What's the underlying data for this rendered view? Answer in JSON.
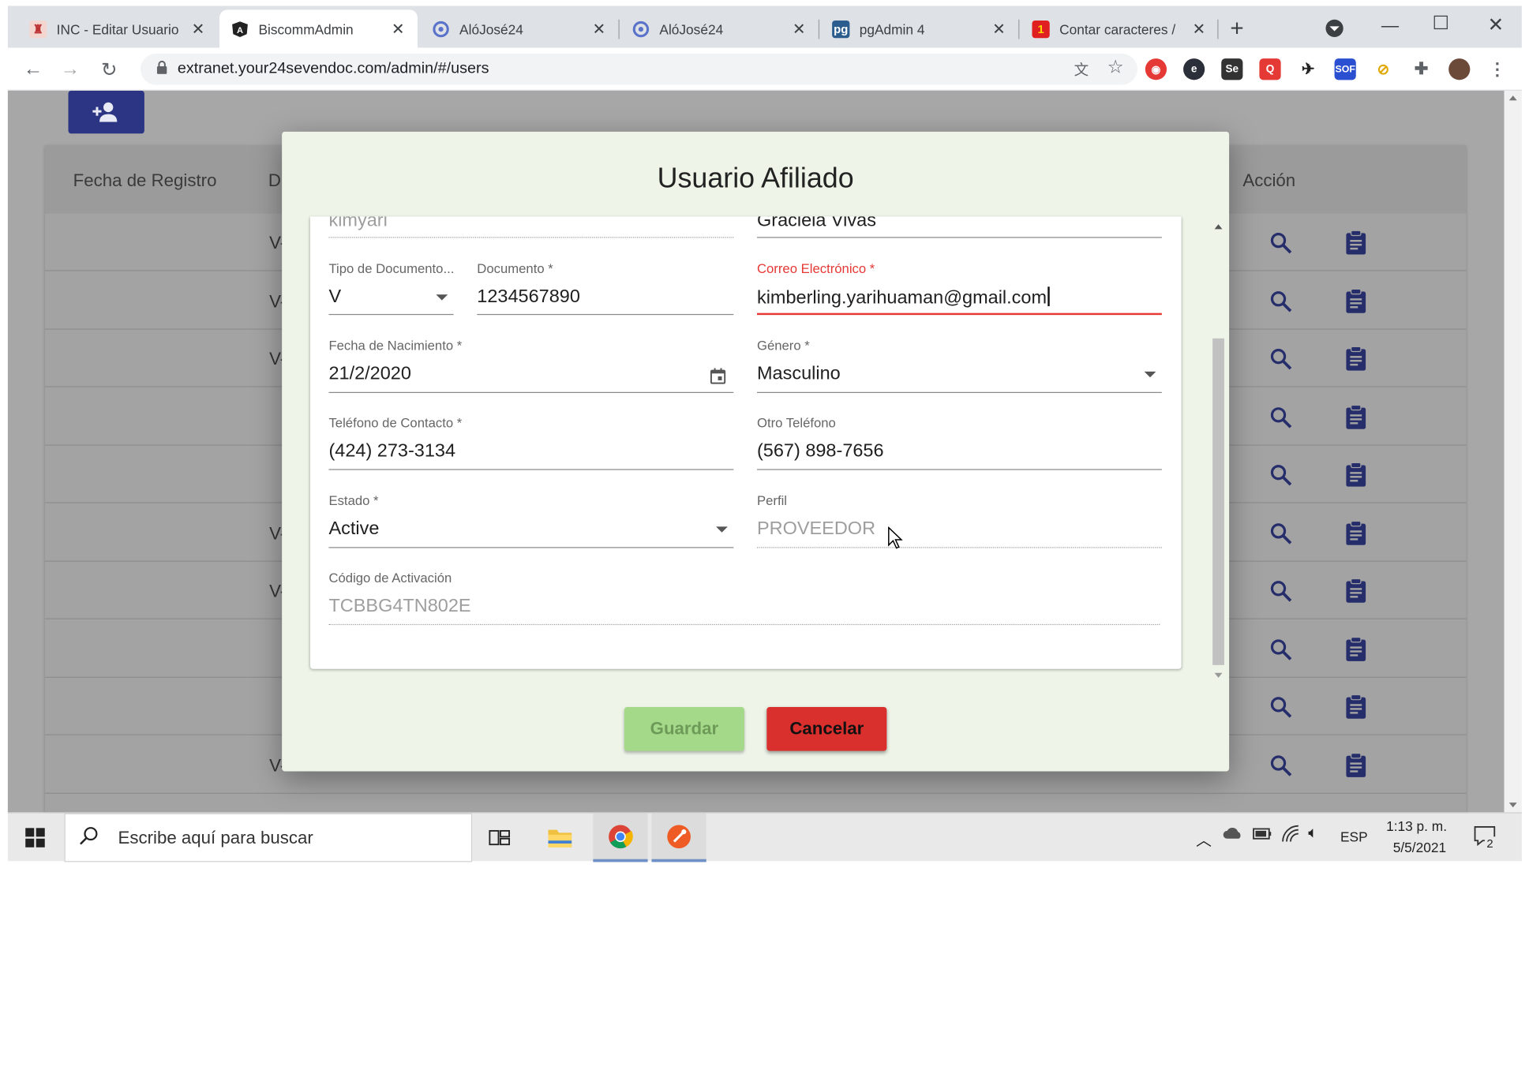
{
  "browser": {
    "tabs": [
      {
        "title": "INC - Editar Usuario",
        "icon": "inc-favicon",
        "active": false
      },
      {
        "title": "BiscommAdmin",
        "icon": "angular-favicon",
        "active": true
      },
      {
        "title": "AlóJosé24",
        "icon": "alojose-favicon",
        "active": false
      },
      {
        "title": "AlóJosé24",
        "icon": "alojose-favicon",
        "active": false
      },
      {
        "title": "pgAdmin 4",
        "icon": "pgadmin-favicon",
        "active": false
      },
      {
        "title": "Contar caracteres /",
        "icon": "counter-favicon",
        "active": false
      }
    ],
    "url": "extranet.your24sevendoc.com/admin/#/users"
  },
  "table": {
    "headers": {
      "fecha": "Fecha de Registro",
      "doc": "D",
      "accion": "Acción"
    },
    "rows": [
      {
        "doc": "V-"
      },
      {
        "doc": "V-"
      },
      {
        "doc": "V-"
      },
      {
        "doc": ""
      },
      {
        "doc": ""
      },
      {
        "doc": "V-"
      },
      {
        "doc": "V-"
      },
      {
        "doc": ""
      },
      {
        "doc": ""
      },
      {
        "doc": "V-"
      }
    ]
  },
  "modal": {
    "title": "Usuario Afiliado",
    "fields": {
      "top_left_value": "kimyari",
      "top_right_value": "Graciela Vivas",
      "tipo_documento": {
        "label": "Tipo de Documento...",
        "value": "V"
      },
      "documento": {
        "label": "Documento *",
        "value": "1234567890"
      },
      "correo": {
        "label": "Correo Electrónico *",
        "value": "kimberling.yarihuaman@gmail.com"
      },
      "fecha_nacimiento": {
        "label": "Fecha de Nacimiento *",
        "value": "21/2/2020"
      },
      "genero": {
        "label": "Género *",
        "value": "Masculino"
      },
      "telefono": {
        "label": "Teléfono de Contacto *",
        "value": "(424) 273-3134"
      },
      "otro_telefono": {
        "label": "Otro Teléfono",
        "value": "(567) 898-7656"
      },
      "estado": {
        "label": "Estado *",
        "value": "Active"
      },
      "perfil": {
        "label": "Perfil",
        "value": "PROVEEDOR"
      },
      "codigo": {
        "label": "Código de Activación",
        "value": "TCBBG4TN802E"
      }
    },
    "buttons": {
      "save": "Guardar",
      "cancel": "Cancelar"
    }
  },
  "taskbar": {
    "search_placeholder": "Escribe aquí para buscar",
    "language": "ESP",
    "time": "1:13 p. m.",
    "date": "5/5/2021",
    "notifications": "2"
  },
  "colors": {
    "accent_blue": "#2b3583",
    "error_red": "#e53935",
    "save_green": "#a5d98a",
    "cancel_red": "#d9302e"
  }
}
